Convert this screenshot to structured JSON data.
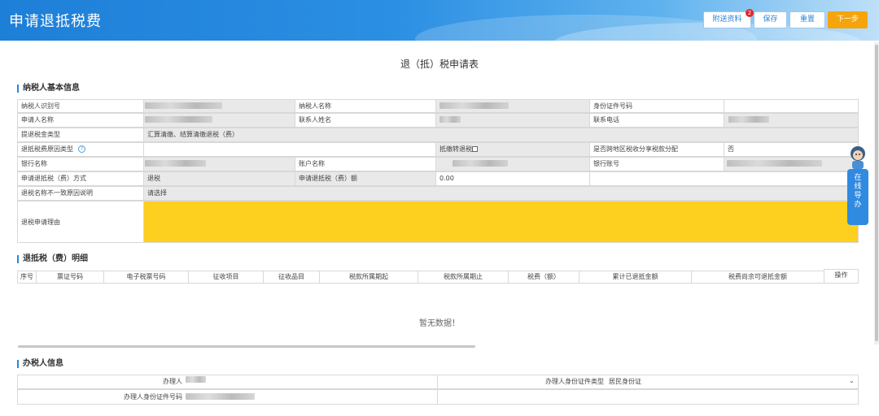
{
  "header": {
    "title": "申请退抵税费",
    "buttons": {
      "attach": "附送资料",
      "save": "保存",
      "reset": "重置",
      "next": "下一步"
    },
    "attach_badge": "2"
  },
  "doc_title": "退（抵）税申请表",
  "section1": {
    "title": "纳税人基本信息",
    "rows": {
      "taxpayer_id": "纳税人识别号",
      "taxpayer_name": "纳税人名称",
      "id_doc_no": "身份证件号码",
      "applicant_name": "申请人名称",
      "contact_name": "联系人姓名",
      "contact_phone": "联系电话",
      "refund_type_label": "提退税金类型",
      "refund_type_value": "汇算清缴、结算清缴退税（费）",
      "reason_type_label": "退抵税费原因类型",
      "help": "?",
      "offset_label": "抵缴转退税",
      "cross_region_label": "是否跨地区税收分享税款分配",
      "cross_region_value": "否",
      "bank_name": "银行名称",
      "account_name": "账户名称",
      "bank_account": "银行账号",
      "method_label": "申请退抵税（费）方式",
      "method_value": "退税",
      "amount_label": "申请退抵税（费）额",
      "amount_value": "0.00",
      "name_diff_label": "退税名称不一致原因说明",
      "name_diff_value": "请选择",
      "reason_label": "退税申请理由"
    }
  },
  "section2": {
    "title": "退抵税（费）明细",
    "columns": [
      "序号",
      "票证号码",
      "电子税票号码",
      "征收项目",
      "征收品目",
      "税款所属期起",
      "税款所属期止",
      "税费（额）",
      "累计已退抵金额",
      "税费尚余可退抵金额",
      "操作"
    ],
    "empty": "暂无数据！"
  },
  "section3": {
    "title": "办税人信息",
    "handler_label": "办理人",
    "id_type_label": "办理人身份证件类型",
    "id_type_value": "居民身份证",
    "id_no_label": "办理人身份证件号码"
  },
  "guide": {
    "chars": [
      "在",
      "线",
      "导",
      "办"
    ]
  },
  "colors": {
    "header": "#2b8fe3",
    "accent": "#f5a40c",
    "highlight": "#fdcf1e"
  }
}
